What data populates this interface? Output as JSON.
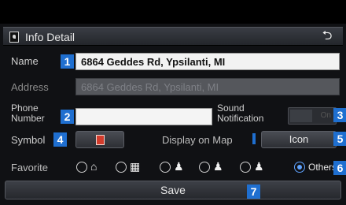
{
  "header": {
    "title": "Info Detail",
    "back_icon": "back-arrow-icon"
  },
  "fields": {
    "name_label": "Name",
    "name_value": "6864 Geddes Rd, Ypsilanti, MI",
    "address_label": "Address",
    "address_value": "6864 Geddes Rd, Ypsilanti, MI",
    "phone_label_line1": "Phone",
    "phone_label_line2": "Number",
    "phone_value": "",
    "sound_label_line1": "Sound",
    "sound_label_line2": "Notification",
    "sound_toggle_state": "On",
    "symbol_label": "Symbol",
    "map_label": "Display on Map",
    "map_value": "Icon"
  },
  "favorite": {
    "label": "Favorite",
    "options": [
      {
        "icon": "home-icon",
        "selected": false
      },
      {
        "icon": "office-icon",
        "selected": false
      },
      {
        "icon": "person-1-icon",
        "selected": false
      },
      {
        "icon": "person-2-icon",
        "selected": false
      },
      {
        "icon": "person-3-icon",
        "selected": false
      },
      {
        "label": "Others",
        "selected": true
      }
    ]
  },
  "save_label": "Save",
  "badges": [
    "1",
    "2",
    "3",
    "4",
    "5",
    "6",
    "7"
  ],
  "colors": {
    "badge": "#1f6fd0",
    "selected_radio": "#5fa3ff",
    "symbol_pin": "#d23c2c"
  }
}
